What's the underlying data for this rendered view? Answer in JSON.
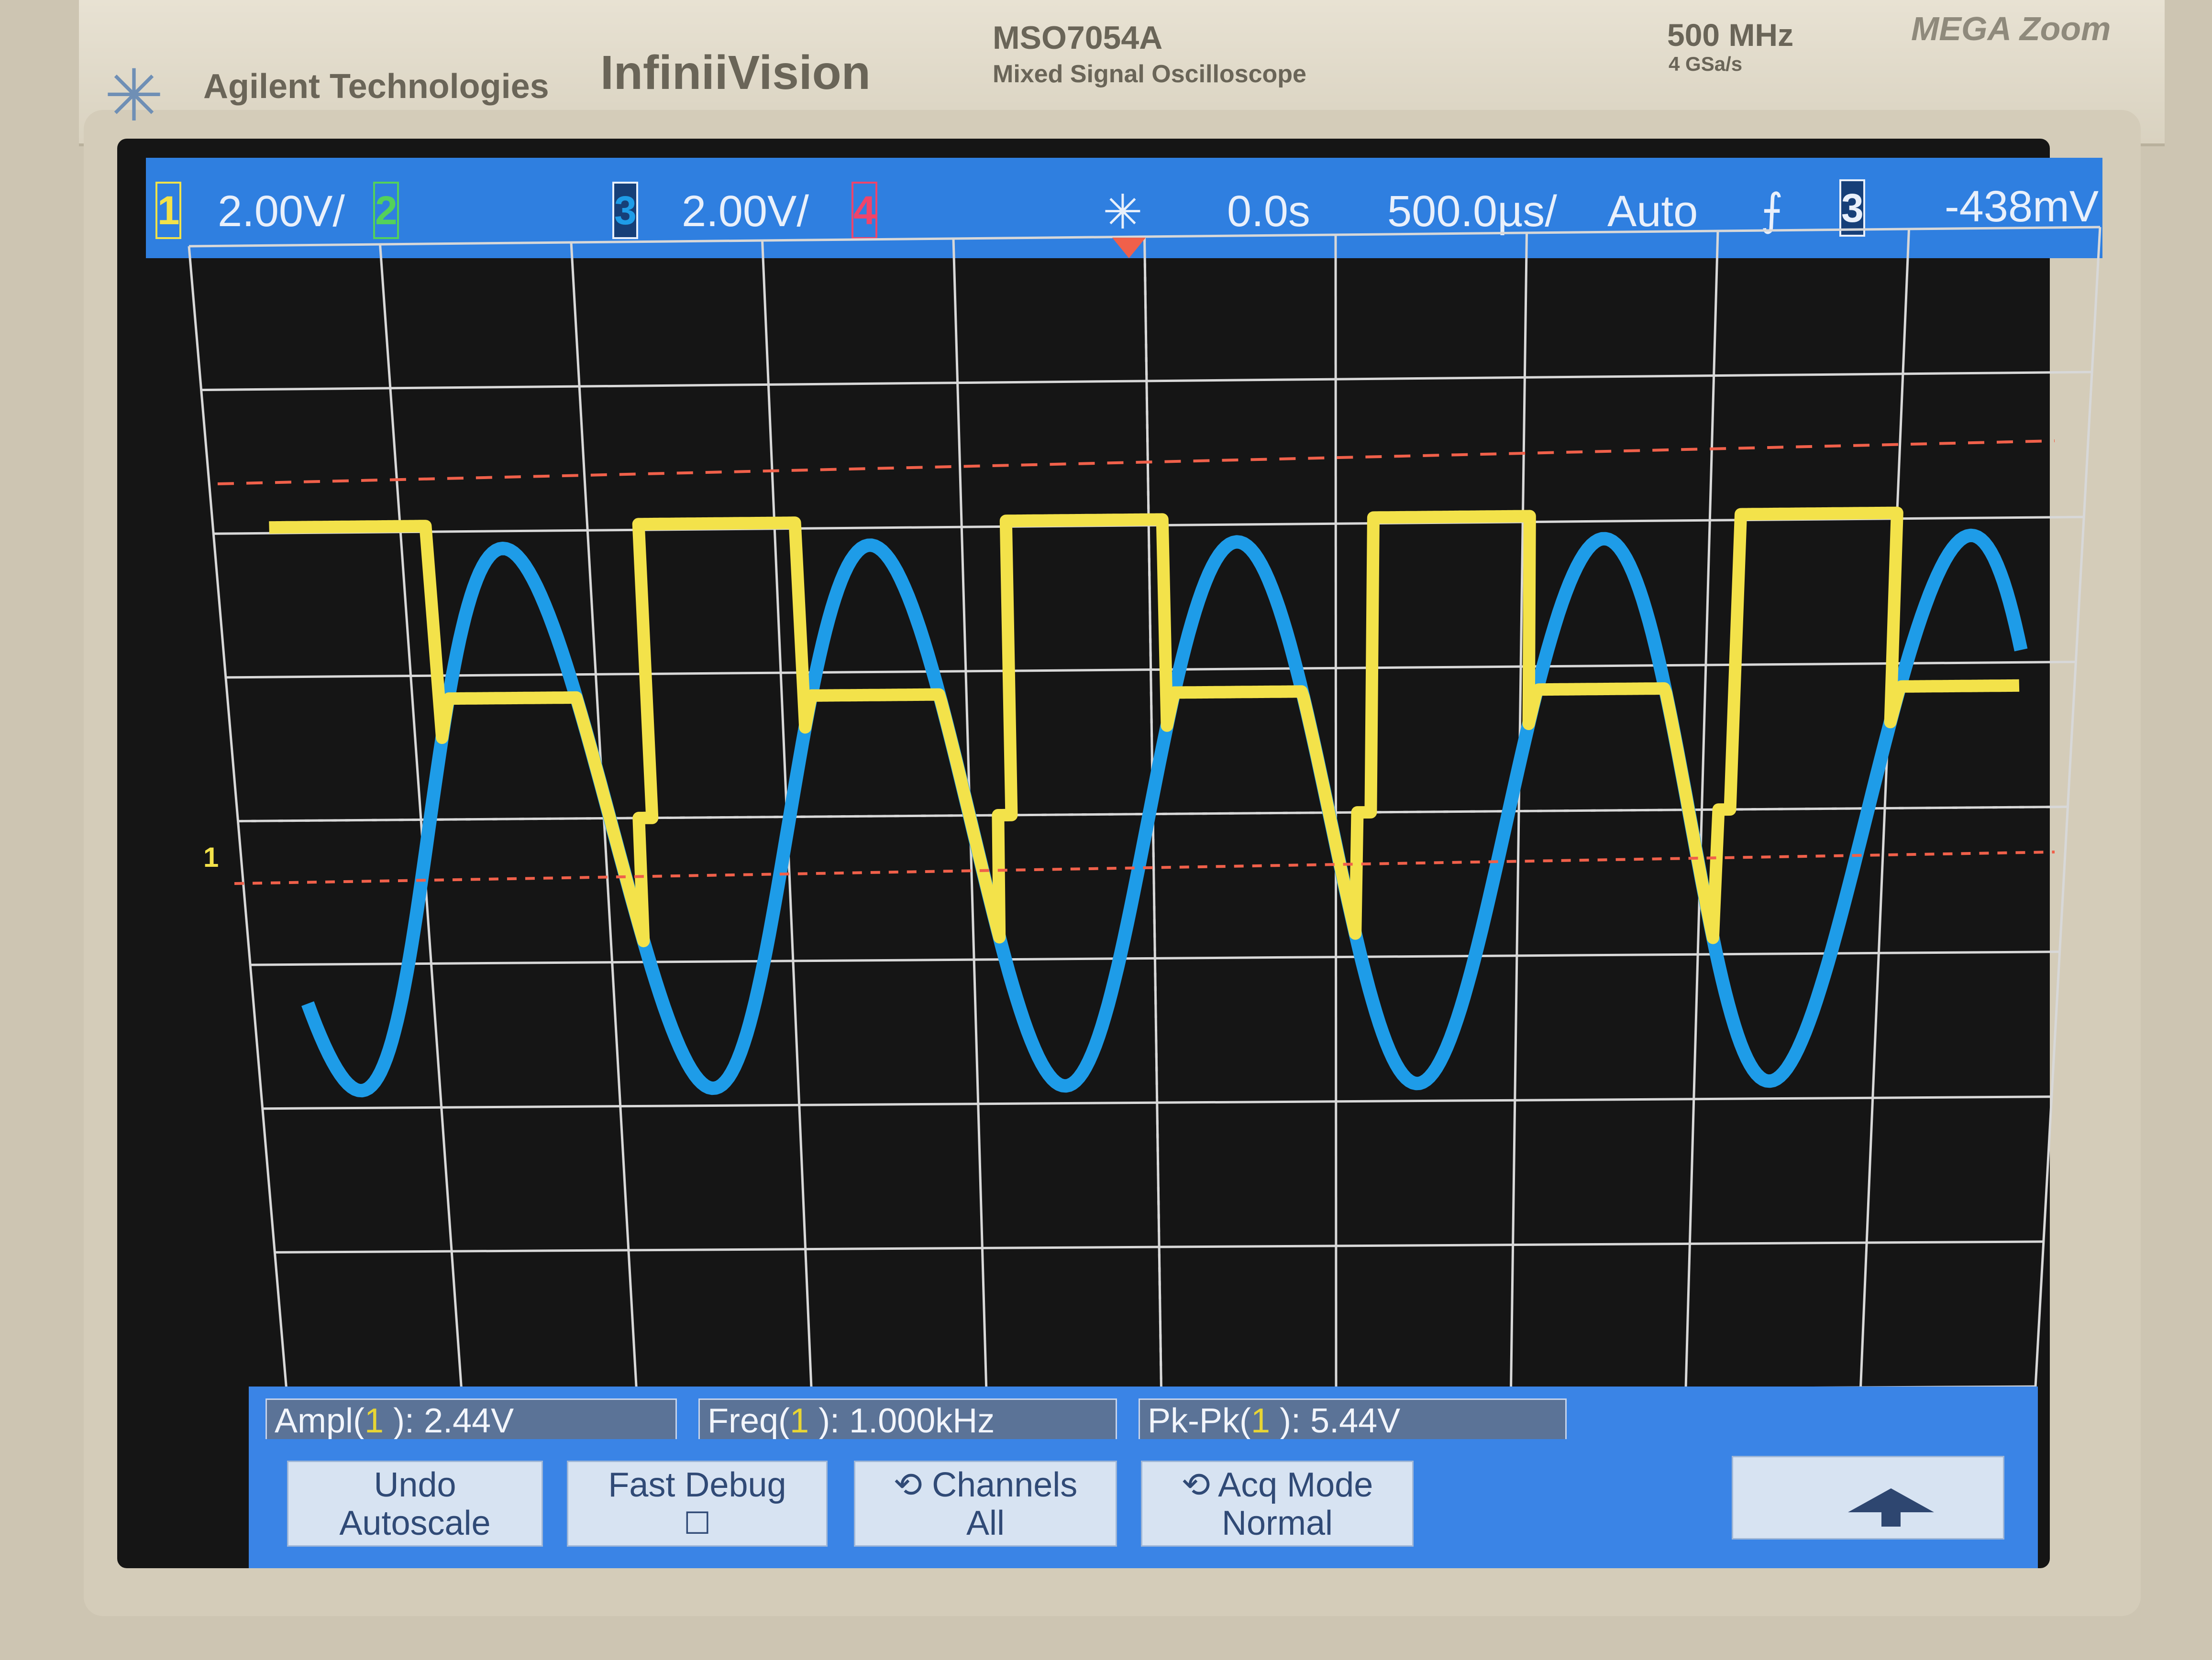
{
  "instrument": {
    "brand": "Agilent Technologies",
    "series": "InfiniiVision",
    "model": "MSO7054A",
    "model_sub": "Mixed Signal Oscilloscope",
    "bandwidth": "500 MHz",
    "sample_rate": "4 GSa/s",
    "zoom_brand": "MEGA Zoom"
  },
  "status": {
    "ch1_label": "1",
    "ch1_scale": "2.00V/",
    "ch2_label": "2",
    "ch3_label": "3",
    "ch3_scale": "2.00V/",
    "ch4_label": "4",
    "time_delay": "0.0s",
    "time_scale": "500.0µs/",
    "trigger_mode": "Auto",
    "trigger_source": "3",
    "trigger_level": "-438mV"
  },
  "markers": {
    "ch1_ground": "1"
  },
  "measurements": [
    {
      "name": "Ampl(",
      "channel": "1",
      "value": " ): 2.44V"
    },
    {
      "name": "Freq(",
      "channel": "1",
      "value": " ): 1.000kHz"
    },
    {
      "name": "Pk-Pk(",
      "channel": "1",
      "value": " ): 5.44V"
    }
  ],
  "softkeys": {
    "undo_line1": "Undo",
    "undo_line2": "Autoscale",
    "fastdebug_line1": "Fast Debug",
    "channels_line1": "Channels",
    "channels_line2": "All",
    "acq_line1": "Acq Mode",
    "acq_line2": "Normal"
  },
  "colors": {
    "ch1": "#f3e24a",
    "ch2": "#53d15a",
    "ch3": "#1e9ce8",
    "ch4": "#f0446a",
    "statusbar": "#2f7fe0",
    "grid": "#d8d8d8"
  },
  "chart_data": {
    "type": "line",
    "series": [
      {
        "name": "1",
        "color": "#f3e24a",
        "shape": "square-over-sine",
        "frequency": "1.000kHz"
      },
      {
        "name": "3",
        "color": "#1e9ce8",
        "shape": "sine",
        "frequency": "1.000kHz"
      }
    ],
    "grid": true
  }
}
